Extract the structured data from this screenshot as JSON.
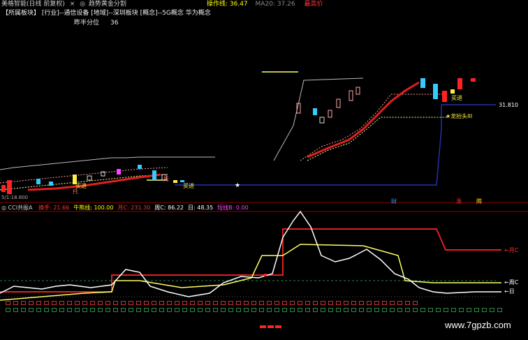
{
  "header": {
    "left_text": "美格智能(日线 前复权)",
    "close_label": "×",
    "formula_title": "趋势黄金分割",
    "op_label": "操作线: 36.47",
    "ma20_label": "MA20: 37.26",
    "max_label": "最高价",
    "colors": {
      "op": "#ffff00",
      "ma20": "#888888",
      "max": "#ff3333"
    }
  },
  "info": {
    "sector_line": "【所属板块】 [行业]--通信设备 [地域]--深圳板块 [概念]--5G概念 华为概念",
    "half_year_label": "昨半分位",
    "half_year_value": "36"
  },
  "upper": {
    "value_label": "31.810",
    "buy_labels": [
      "买进",
      "买进",
      "买进"
    ],
    "dragon_label": "★龙抬头III",
    "marker_chars": [
      "托",
      "托"
    ],
    "bottom_small": "5/1:18.800",
    "event_markers": [
      "财",
      "涨",
      "腾"
    ]
  },
  "lower": {
    "indicator_name": "CCI共振A",
    "items": [
      {
        "label": "换手: 21.66",
        "color": "#ff3333"
      },
      {
        "label": "牛熊线: 100.00",
        "color": "#ffff00"
      },
      {
        "label": "月C: 231.30",
        "color": "#ff3333"
      },
      {
        "label": "周C: 86.22",
        "color": "#ffffff"
      },
      {
        "label": "日: 48.35",
        "color": "#ffffff"
      },
      {
        "label": "短线B: 0.00",
        "color": "#ff44ff"
      }
    ],
    "right_labels": {
      "month": "←月C",
      "week": "←周C",
      "day": "←日"
    }
  },
  "watermark": "www.7gpzb.com"
}
